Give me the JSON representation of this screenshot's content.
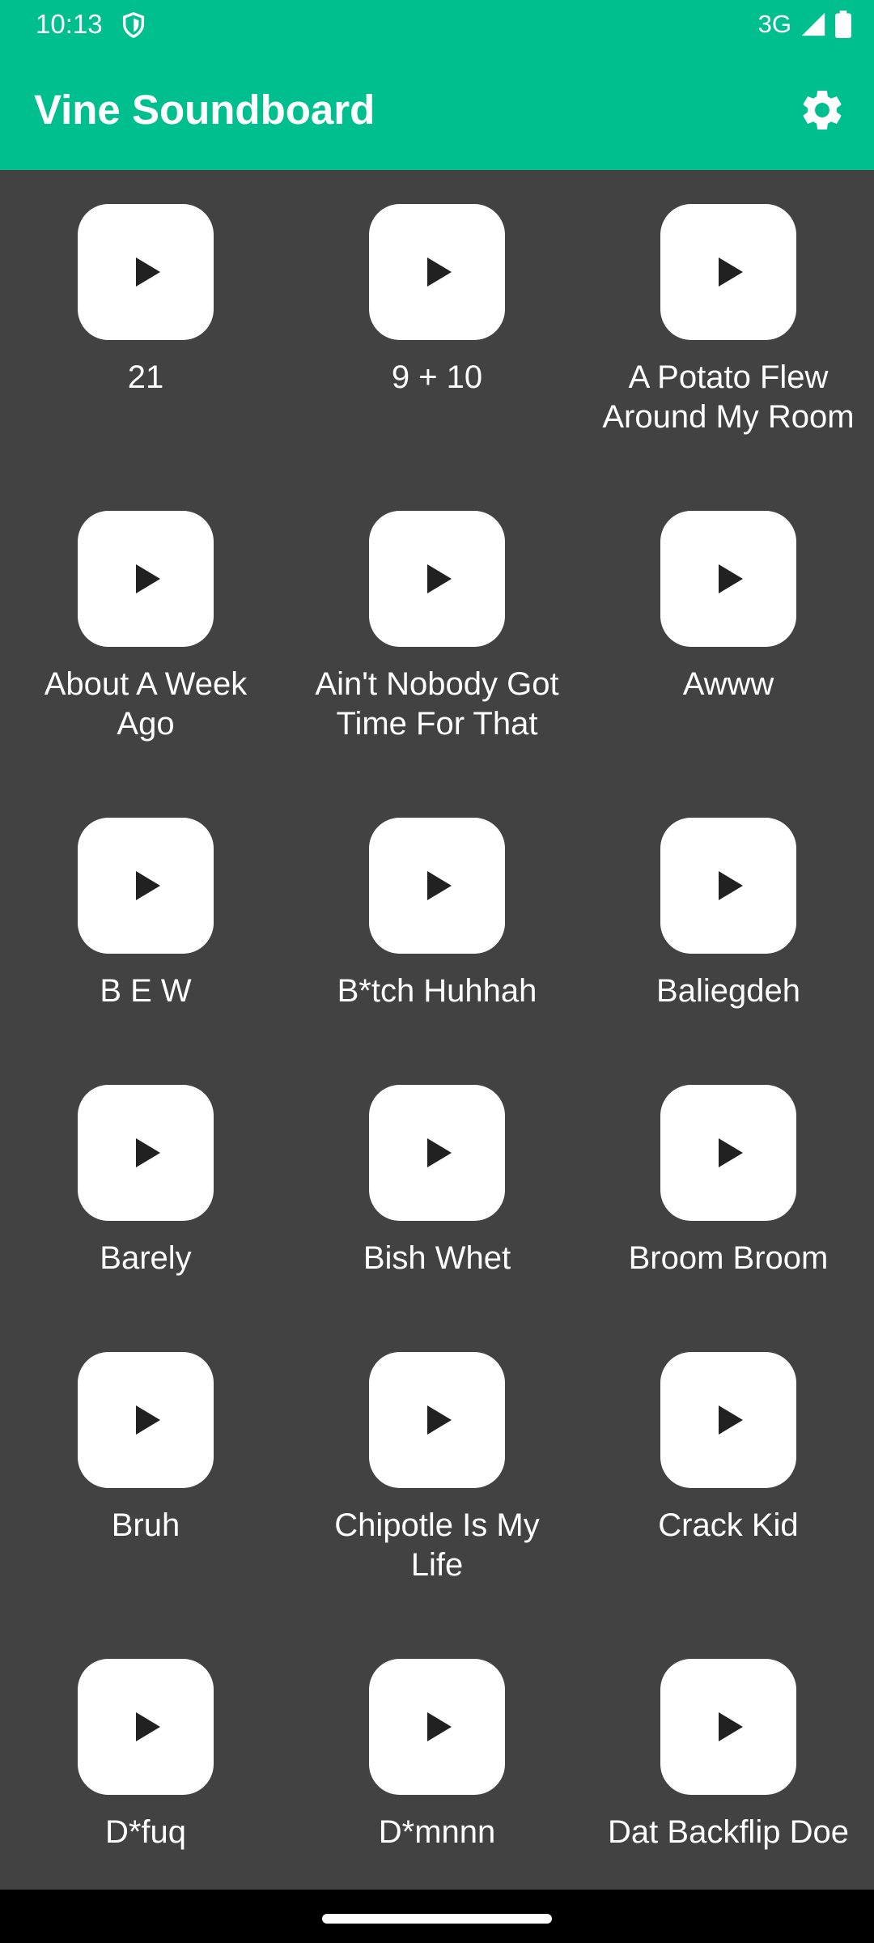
{
  "status_bar": {
    "time": "10:13",
    "network": "3G"
  },
  "app_bar": {
    "title": "Vine Soundboard",
    "settings_icon": "gear-icon"
  },
  "colors": {
    "primary": "#00BF8F",
    "background": "#424242",
    "card": "#FFFFFF"
  },
  "sounds": [
    {
      "label": "21"
    },
    {
      "label": "9 + 10"
    },
    {
      "label": "A Potato Flew Around My Room"
    },
    {
      "label": "About A Week Ago"
    },
    {
      "label": "Ain't Nobody Got Time For That"
    },
    {
      "label": "Awww"
    },
    {
      "label": "B E W"
    },
    {
      "label": "B*tch Huhhah"
    },
    {
      "label": "Baliegdeh"
    },
    {
      "label": "Barely"
    },
    {
      "label": "Bish Whet"
    },
    {
      "label": "Broom Broom"
    },
    {
      "label": "Bruh"
    },
    {
      "label": "Chipotle Is My Life"
    },
    {
      "label": "Crack Kid"
    },
    {
      "label": "D*fuq"
    },
    {
      "label": "D*mnnn"
    },
    {
      "label": "Dat Backflip Doe"
    }
  ]
}
